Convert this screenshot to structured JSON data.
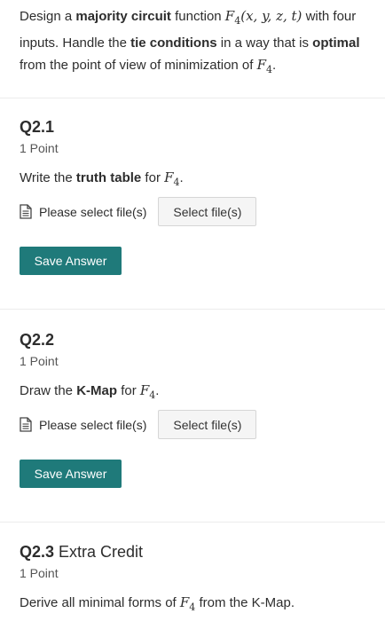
{
  "intro": {
    "t1": "Design a ",
    "b1": "majority circuit",
    "t2": " function ",
    "math_fn": "F",
    "math_sub": "4",
    "math_args": "(x, y, z, t)",
    "t3": " with four inputs. Handle the ",
    "b2": "tie conditions",
    "t4": " in a way that is ",
    "b3": "optimal",
    "t5": " from the point of view of minimization of ",
    "math_f": "F",
    "math_f_sub": "4",
    "t6": "."
  },
  "questions": [
    {
      "title": "Q2.1",
      "points": "1 Point",
      "prompt_pre": "Write the ",
      "prompt_bold": "truth table",
      "prompt_mid": " for ",
      "prompt_math": "F",
      "prompt_math_sub": "4",
      "prompt_post": ".",
      "file_label": "Please select file(s)",
      "select_label": "Select file(s)",
      "save_label": "Save Answer"
    },
    {
      "title": "Q2.2",
      "points": "1 Point",
      "prompt_pre": "Draw the ",
      "prompt_bold": "K-Map",
      "prompt_mid": " for ",
      "prompt_math": "F",
      "prompt_math_sub": "4",
      "prompt_post": ".",
      "file_label": "Please select file(s)",
      "select_label": "Select file(s)",
      "save_label": "Save Answer"
    },
    {
      "title": "Q2.3",
      "title_extra": " Extra Credit",
      "points": "1 Point",
      "prompt_pre": "Derive all minimal forms of ",
      "prompt_math": "F",
      "prompt_math_sub": "4",
      "prompt_post": " from the K-Map."
    }
  ],
  "colors": {
    "accent": "#1f7a7a",
    "divider": "#ececec",
    "text": "#2d2d2d"
  },
  "icons": {
    "file": "file-document-icon"
  }
}
